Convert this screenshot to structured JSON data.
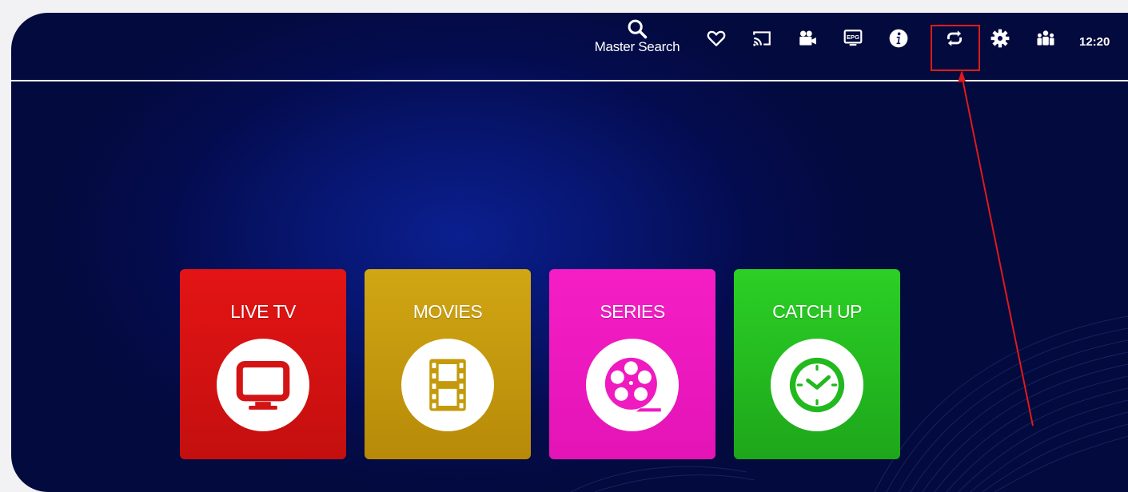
{
  "header": {
    "search_label": "Master Search",
    "clock": "12:20",
    "icons": [
      "search-icon",
      "heart-icon",
      "cast-icon",
      "video-camera-icon",
      "epg-icon",
      "info-icon",
      "refresh-icon",
      "gear-icon",
      "users-icon"
    ],
    "highlighted_icon": "refresh-icon",
    "highlight_color": "#e01a1a"
  },
  "tiles": [
    {
      "label": "LIVE TV",
      "icon": "tv-icon",
      "color": "#d41414"
    },
    {
      "label": "MOVIES",
      "icon": "film-icon",
      "color": "#c49a0c"
    },
    {
      "label": "SERIES",
      "icon": "film-reel-icon",
      "color": "#ef1ac0"
    },
    {
      "label": "CATCH UP",
      "icon": "clock-icon",
      "color": "#22b91e"
    }
  ],
  "colors": {
    "background": "#040c4f",
    "divider": "#ffffff"
  }
}
